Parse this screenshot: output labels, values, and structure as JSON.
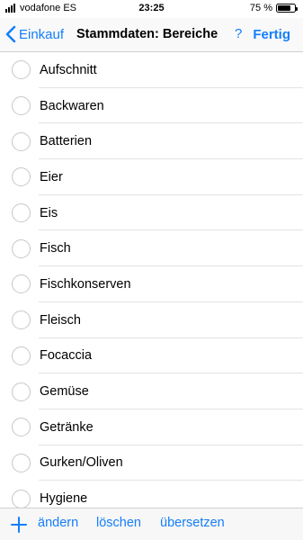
{
  "status_bar": {
    "carrier": "vodafone ES",
    "time": "23:25",
    "battery_percent": "75 %",
    "battery_level": 0.75
  },
  "nav_bar": {
    "back_label": "Einkauf",
    "title": "Stammdaten: Bereiche",
    "help_label": "?",
    "done_label": "Fertig"
  },
  "list": {
    "items": [
      {
        "label": "Aufschnitt"
      },
      {
        "label": "Backwaren"
      },
      {
        "label": "Batterien"
      },
      {
        "label": "Eier"
      },
      {
        "label": "Eis"
      },
      {
        "label": "Fisch"
      },
      {
        "label": "Fischkonserven"
      },
      {
        "label": "Fleisch"
      },
      {
        "label": "Focaccia"
      },
      {
        "label": "Gemüse"
      },
      {
        "label": "Getränke"
      },
      {
        "label": "Gurken/Oliven"
      },
      {
        "label": "Hygiene"
      }
    ]
  },
  "toolbar": {
    "add_icon": "plus-icon",
    "change_label": "ändern",
    "delete_label": "löschen",
    "translate_label": "übersetzen"
  },
  "colors": {
    "accent": "#147efb",
    "separator": "#e3e3e6",
    "radio_border": "#c7c7cc"
  }
}
